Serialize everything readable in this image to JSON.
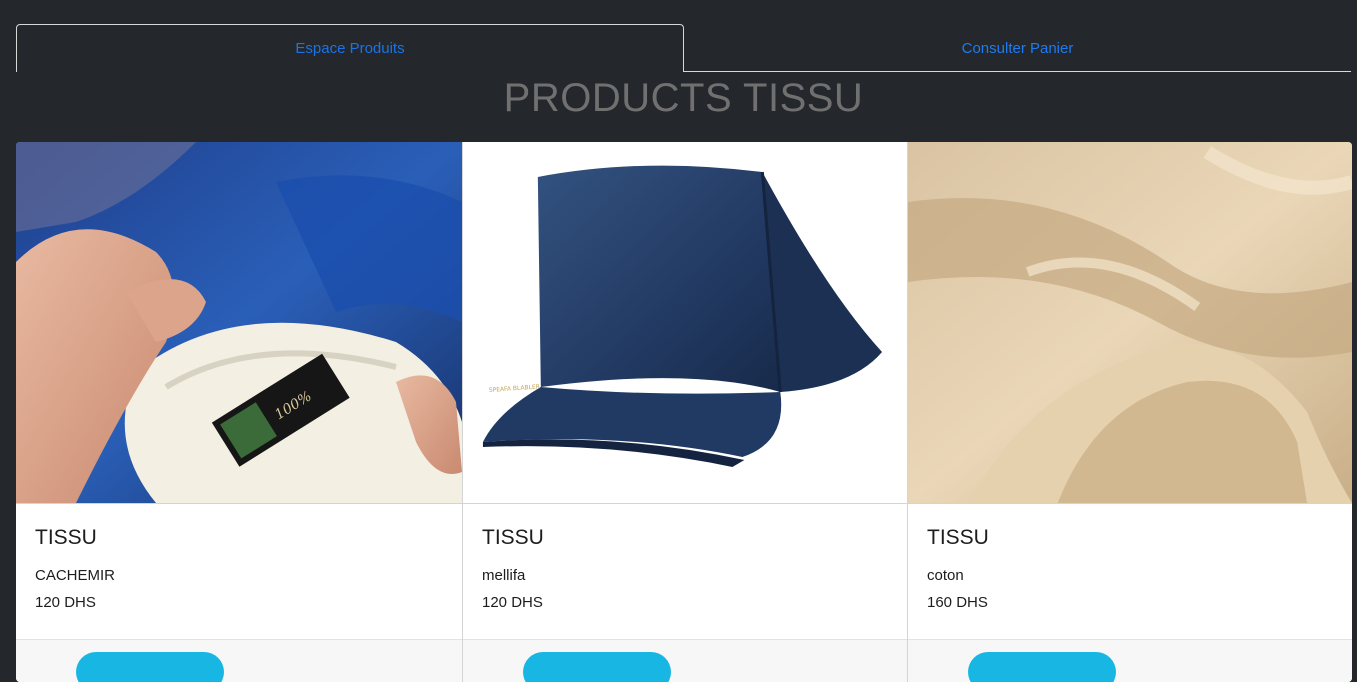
{
  "tabs": {
    "products_label": "Espace Produits",
    "cart_label": "Consulter Panier"
  },
  "page": {
    "title": "PRODUCTS TISSU"
  },
  "colors": {
    "background": "#24272b",
    "tab_text": "#1a73e8",
    "title_text": "#707070",
    "button": "#17b6e3"
  },
  "products": [
    {
      "title": "TISSU",
      "name": "CACHEMIR",
      "price": "120 DHS",
      "image": "cashmere-fabric-photo"
    },
    {
      "title": "TISSU",
      "name": "mellifa",
      "price": "120 DHS",
      "image": "navy-folded-fabric-photo"
    },
    {
      "title": "TISSU",
      "name": "coton",
      "price": "160 DHS",
      "image": "beige-cotton-fabric-photo"
    }
  ]
}
